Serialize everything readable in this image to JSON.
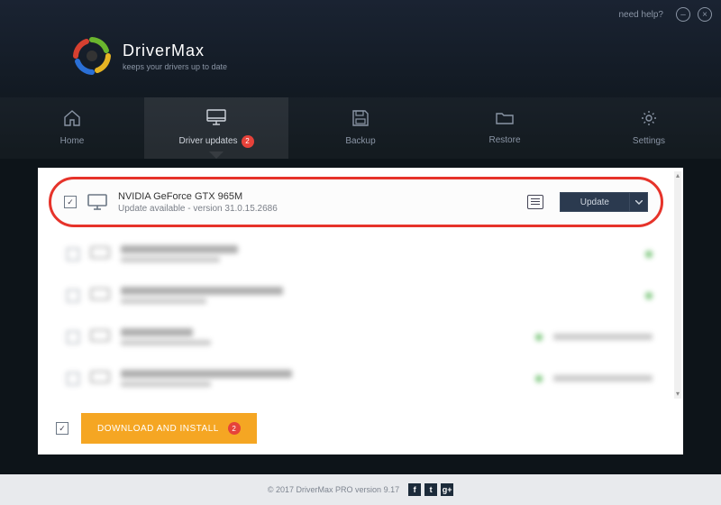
{
  "window": {
    "help_label": "need help?",
    "minimize_glyph": "–",
    "close_glyph": "×"
  },
  "brand": {
    "name": "DriverMax",
    "tagline": "keeps your drivers up to date"
  },
  "nav": {
    "home": "Home",
    "updates": "Driver updates",
    "updates_badge": "2",
    "backup": "Backup",
    "restore": "Restore",
    "settings": "Settings"
  },
  "highlighted": {
    "title": "NVIDIA GeForce GTX 965M",
    "subtitle": "Update available - version 31.0.15.2686",
    "update_label": "Update",
    "checkbox_glyph": "✓"
  },
  "blurred_rows": [
    {
      "title_w": 130,
      "sub_w": 110
    },
    {
      "title_w": 180,
      "sub_w": 95
    },
    {
      "title_w": 80,
      "sub_w": 100,
      "status": true
    },
    {
      "title_w": 190,
      "sub_w": 100,
      "status": true
    }
  ],
  "footer": {
    "download_label": "DOWNLOAD AND INSTALL",
    "download_badge": "2",
    "checkbox_glyph": "✓"
  },
  "bottombar": {
    "copyright": "© 2017 DriverMax PRO version 9.17",
    "social": [
      "f",
      "t",
      "g+"
    ]
  },
  "colors": {
    "highlight_ring": "#e6332a",
    "accent_orange": "#f5a623",
    "badge_red": "#e6423a"
  }
}
